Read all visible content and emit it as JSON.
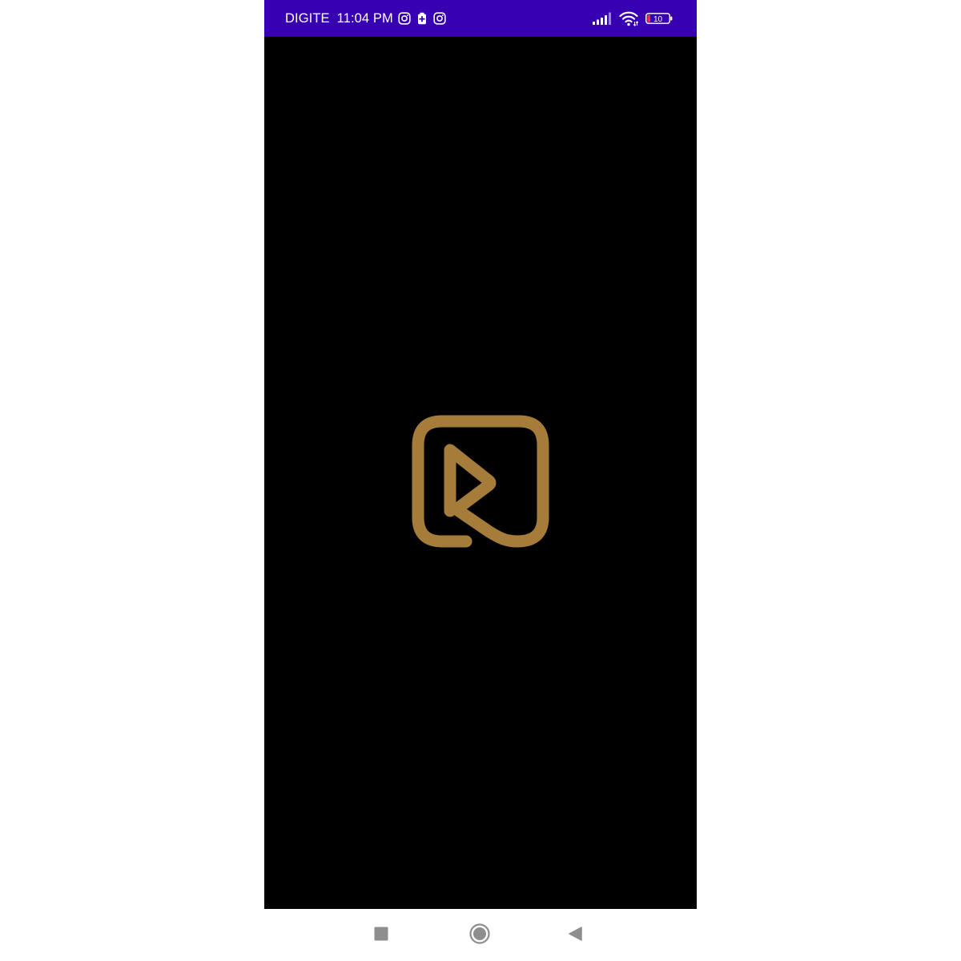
{
  "status_bar": {
    "carrier": "DIGITE",
    "time": "11:04 PM",
    "battery_level": "10",
    "colors": {
      "background": "#3700b3",
      "foreground": "#ffffff",
      "battery_low": "#e53935"
    },
    "icons": [
      "instagram-icon",
      "battery-saver-icon",
      "instagram-icon",
      "signal-icon",
      "wifi-icon",
      "battery-icon"
    ]
  },
  "splash": {
    "background": "#000000",
    "logo_color": "#a67c3a",
    "logo_icon": "play-logo-icon"
  },
  "nav_bar": {
    "buttons": [
      "recents-button",
      "home-button",
      "back-button"
    ],
    "icon_color": "#8e8e8e"
  }
}
